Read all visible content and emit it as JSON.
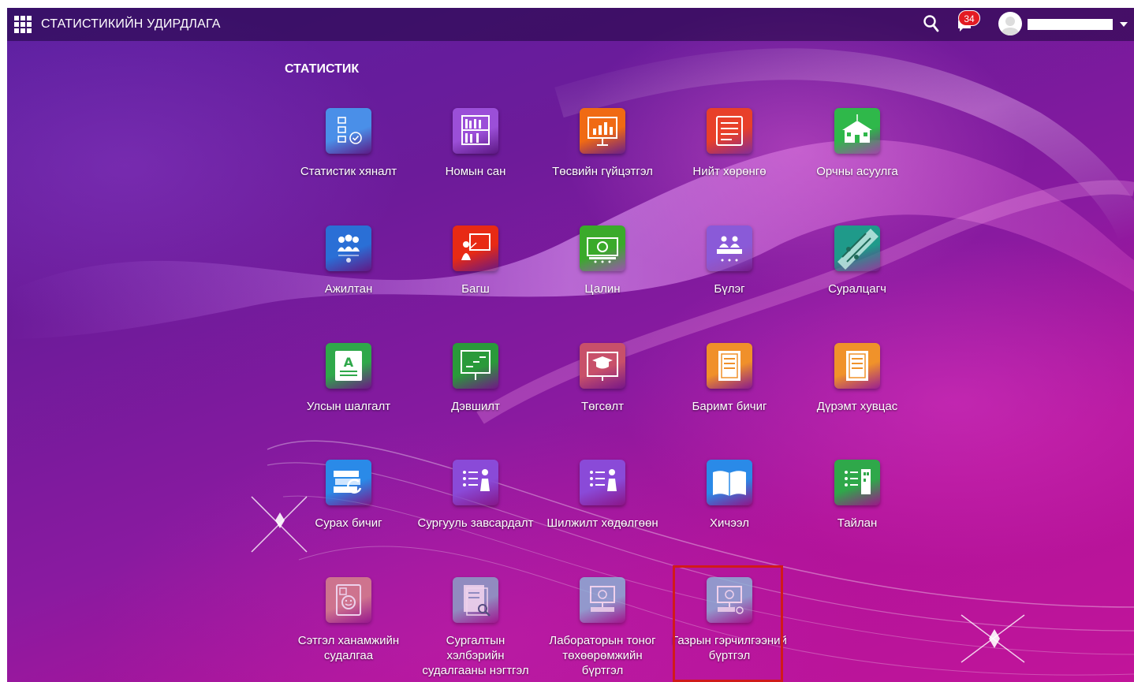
{
  "header": {
    "app_title": "СТАТИСТИКИЙН УДИРДЛАГА",
    "notification_count": "34"
  },
  "section": {
    "title": "СТАТИСТИК"
  },
  "tiles": [
    {
      "label": "Статистик хяналт",
      "icon": "flowchart-check-icon",
      "color": "#4a8fe8"
    },
    {
      "label": "Номын сан",
      "icon": "library-shelf-icon",
      "color": "#9b4fd8"
    },
    {
      "label": "Төсвийн гүйцэтгэл",
      "icon": "presentation-chart-icon",
      "color": "#f06a14"
    },
    {
      "label": "Нийт хөрөнгө",
      "icon": "list-document-icon",
      "color": "#e8402a"
    },
    {
      "label": "Орчны асуулга",
      "icon": "school-building-icon",
      "color": "#2fb84a"
    },
    {
      "label": "Ажилтан",
      "icon": "staff-group-icon",
      "color": "#2a6fd6"
    },
    {
      "label": "Багш",
      "icon": "teacher-board-icon",
      "color": "#e82a14"
    },
    {
      "label": "Цалин",
      "icon": "money-bill-icon",
      "color": "#3aaa2a"
    },
    {
      "label": "Бүлэг",
      "icon": "classroom-group-icon",
      "color": "#8a5ad8"
    },
    {
      "label": "Суралцагч",
      "icon": "student-diagonal-icon",
      "color": "#1f9a8a"
    },
    {
      "label": "Улсын шалгалт",
      "icon": "exam-letter-a-icon",
      "color": "#2fa84a"
    },
    {
      "label": "Дэвшилт",
      "icon": "progress-board-icon",
      "color": "#2a9a3a"
    },
    {
      "label": "Төгсөлт",
      "icon": "graduation-cap-icon",
      "color": "#c8506a"
    },
    {
      "label": "Баримт бичиг",
      "icon": "document-page-icon",
      "color": "#f0902a"
    },
    {
      "label": "Дүрэмт хувцас",
      "icon": "uniform-doc-icon",
      "color": "#f0922a"
    },
    {
      "label": "Сурах бичиг",
      "icon": "textbook-stack-icon",
      "color": "#2a8ae8"
    },
    {
      "label": "Сургууль завсардалт",
      "icon": "dropout-list-icon",
      "color": "#8a4ad8"
    },
    {
      "label": "Шилжилт хөдөлгөөн",
      "icon": "transfer-list-icon",
      "color": "#8a4ad8"
    },
    {
      "label": "Хичээл",
      "icon": "open-book-icon",
      "color": "#2a8ae8"
    },
    {
      "label": "Тайлан",
      "icon": "report-list-icon",
      "color": "#2fa84a"
    },
    {
      "label": "Сэтгэл ханамжийн судалгаа",
      "icon": "satisfaction-survey-icon",
      "color": "#d88a8a"
    },
    {
      "label": "Сургалтын хэлбэрийн судалгааны нэгтгэл",
      "icon": "search-document-icon",
      "color": "#8aa8c8"
    },
    {
      "label": "Лабораторын тоног төхөөрөмжийн бүртгэл",
      "icon": "lab-equipment-icon",
      "color": "#8ab8d8"
    },
    {
      "label": "Газрын гэрчилгээний бүртгэл",
      "icon": "land-certificate-icon",
      "color": "#8ab8d8"
    }
  ]
}
